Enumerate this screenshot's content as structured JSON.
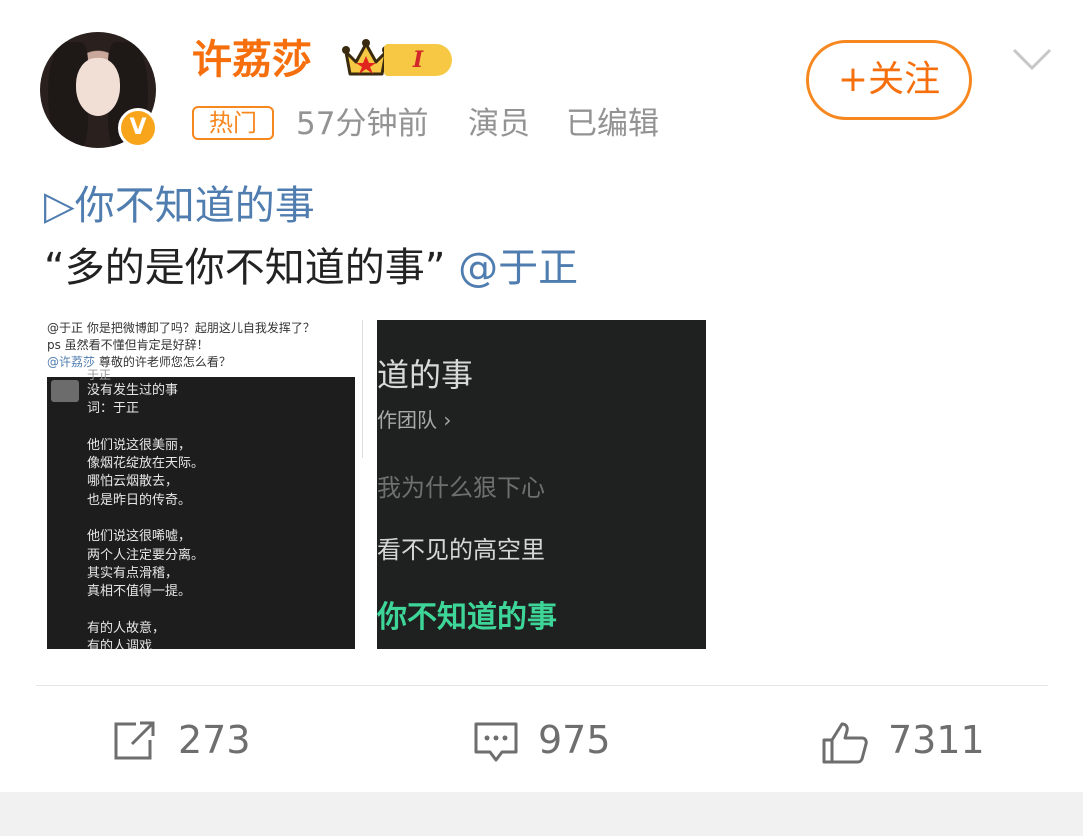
{
  "header": {
    "username": "许荔莎",
    "level": "I",
    "hot_tag": "热门",
    "time": "57分钟前",
    "role": "演员",
    "edited": "已编辑",
    "follow_label": "+关注",
    "verified_mark": "V"
  },
  "post": {
    "music_link": "▷你不知道的事",
    "quote": "“多的是你不知道的事”",
    "mention": "@于正"
  },
  "image1": {
    "line1": "@于正 你是把微博卸了吗？起朋这儿自我发挥了？",
    "line2": "ps 虽然看不懂但肯定是好辞！",
    "line3_mention": "@许荔莎",
    "line3_text": " 尊敬的许老师您怎么看？",
    "author": "于正",
    "lyrics": "没有发生过的事\n词：于正\n\n他们说这很美丽，\n像烟花绽放在天际。\n哪怕云烟散去，\n也是昨日的传奇。\n\n他们说这很唏嘘，\n两个人注定要分离。\n其实有点滑稽，\n真相不值得一提。\n\n有的人故意，\n有的人调戏"
  },
  "image2": {
    "title": "道的事",
    "team": "作团队 ›",
    "lyric1": "我为什么狠下心",
    "lyric2": "看不见的高空里",
    "lyric3": "你不知道的事"
  },
  "actions": {
    "share_count": "273",
    "comment_count": "975",
    "like_count": "7311"
  },
  "colors": {
    "accent": "#f66f0c",
    "link": "#507daf",
    "highlight_lyric": "#3ed598"
  }
}
